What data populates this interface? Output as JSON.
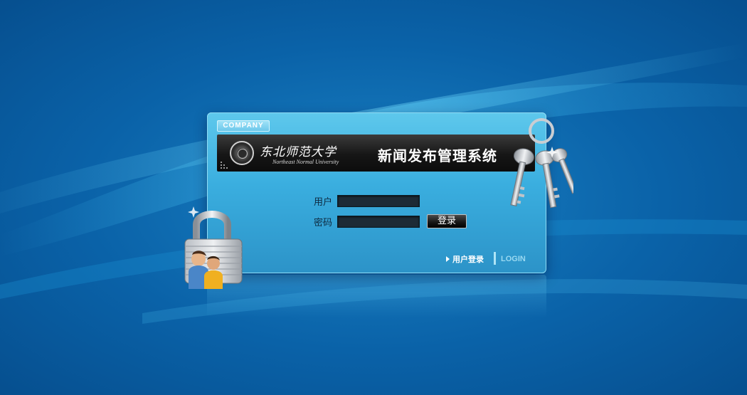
{
  "brand": {
    "company_tag": "COMPANY",
    "university_name": "东北师范大学",
    "university_english": "Northeast Normal University",
    "system_title": "新闻发布管理系统"
  },
  "form": {
    "username_label": "用户",
    "password_label": "密码",
    "username_value": "",
    "password_value": "",
    "submit_label": "登录"
  },
  "footer": {
    "user_login": "用户登录",
    "login_en": "LOGIN"
  },
  "colors": {
    "background": "#0a62a8",
    "panel": "#3aaedf",
    "title_bar": "#161616"
  },
  "icons": {
    "padlock": "padlock-users-icon",
    "keys": "keys-icon"
  }
}
